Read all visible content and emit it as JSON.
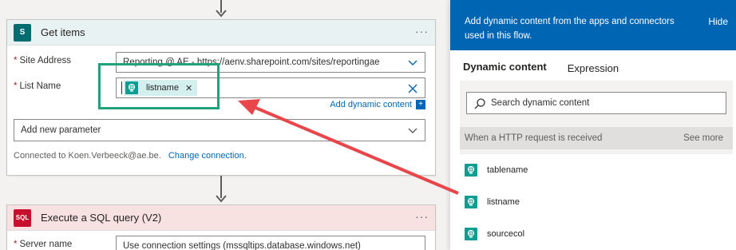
{
  "colors": {
    "accent": "#0065b3",
    "sharepoint": "#036c70",
    "sql": "#c8102e",
    "token_icon": "#0e9d93",
    "highlight": "#21a27b",
    "arrow": "#e8464a"
  },
  "get_items": {
    "title": "Get items",
    "icon": "sharepoint-icon",
    "site_address_label": "Site Address",
    "site_address_value": "Reporting @ AE - https://aenv.sharepoint.com/sites/reportingae",
    "list_name_label": "List Name",
    "list_token": "listname",
    "add_dynamic": "Add dynamic content",
    "new_param": "Add new parameter",
    "connected_text": "Connected to Koen.Verbeeck@ae.be.",
    "change_connection": "Change connection."
  },
  "sql": {
    "title": "Execute a SQL query (V2)",
    "icon": "sql-icon",
    "server_label": "Server name",
    "server_value": "Use connection settings (mssqltips.database.windows.net)"
  },
  "panel": {
    "header_text": "Add dynamic content from the apps and connectors used in this flow.",
    "hide": "Hide",
    "tab_dynamic": "Dynamic content",
    "tab_expression": "Expression",
    "search_placeholder": "Search dynamic content",
    "section_title": "When a HTTP request is received",
    "see_more": "See more",
    "items": [
      {
        "label": "tablename"
      },
      {
        "label": "listname"
      },
      {
        "label": "sourcecol"
      }
    ]
  }
}
